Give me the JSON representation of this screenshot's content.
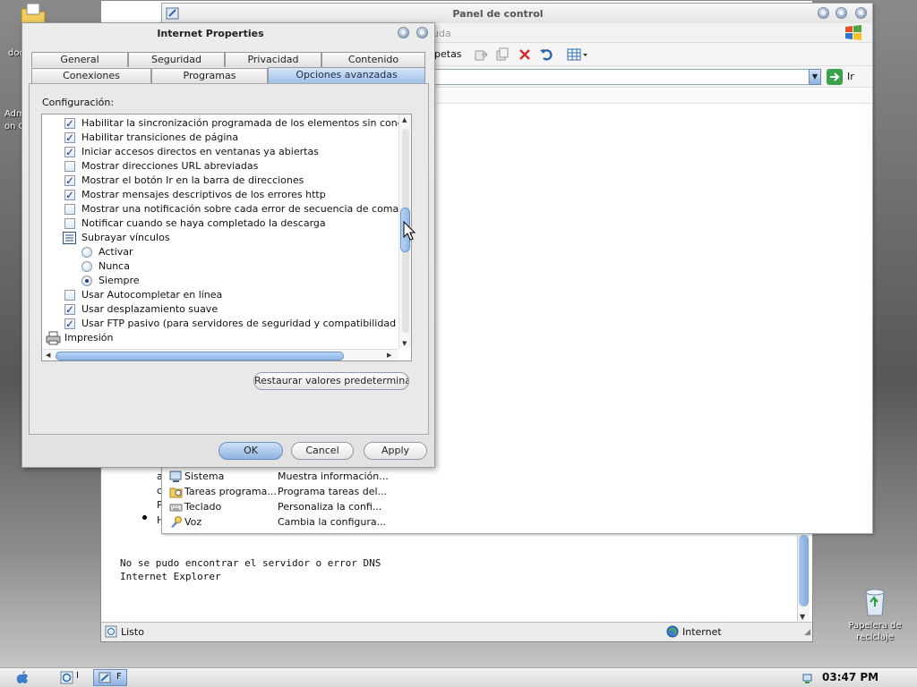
{
  "desktop": {
    "icon_left_labels": [
      "doc",
      "Adm",
      "on C"
    ],
    "recycle_bin_label": "Papelera de reciclaje"
  },
  "ie_window": {
    "bullets": [
      "a",
      "c",
      "P",
      "H"
    ],
    "error_text_1": "No se pudo encontrar el servidor o error DNS",
    "error_text_2": "Internet Explorer",
    "status_left": "Listo",
    "status_zone": "Internet"
  },
  "control_panel": {
    "title": "Panel de control",
    "menu_fragment": "uda",
    "toolbar_fragment": "petas",
    "go_label": "Ir",
    "items": [
      {
        "name": "Sistema",
        "desc": "Muestra información..."
      },
      {
        "name": "Tareas programa...",
        "desc": "Programa tareas del..."
      },
      {
        "name": "Teclado",
        "desc": "Personaliza la confi..."
      },
      {
        "name": "Voz",
        "desc": "Cambia la configura..."
      }
    ]
  },
  "dialog": {
    "title": "Internet Properties",
    "tabs_row1": [
      "General",
      "Seguridad",
      "Privacidad",
      "Contenido"
    ],
    "tabs_row2": [
      "Conexiones",
      "Programas",
      "Opciones avanzadas"
    ],
    "selected_tab": "Opciones avanzadas",
    "config_label": "Configuración:",
    "settings": [
      {
        "type": "checkbox",
        "checked": true,
        "label": "Habilitar la sincronización programada de los elementos sin conexión"
      },
      {
        "type": "checkbox",
        "checked": true,
        "label": "Habilitar transiciones de página"
      },
      {
        "type": "checkbox",
        "checked": true,
        "label": "Iniciar accesos directos en ventanas ya abiertas"
      },
      {
        "type": "checkbox",
        "checked": false,
        "label": "Mostrar direcciones URL abreviadas"
      },
      {
        "type": "checkbox",
        "checked": true,
        "label": "Mostrar el botón Ir en la barra de direcciones"
      },
      {
        "type": "checkbox",
        "checked": true,
        "label": "Mostrar mensajes descriptivos de los errores http"
      },
      {
        "type": "checkbox",
        "checked": false,
        "label": "Mostrar una notificación sobre cada error de secuencia de comandos"
      },
      {
        "type": "checkbox",
        "checked": false,
        "label": "Notificar cuando se haya completado la descarga"
      },
      {
        "type": "group",
        "label": "Subrayar vínculos"
      },
      {
        "type": "radio",
        "checked": false,
        "label": "Activar"
      },
      {
        "type": "radio",
        "checked": false,
        "label": "Nunca"
      },
      {
        "type": "radio",
        "checked": true,
        "label": "Siempre"
      },
      {
        "type": "checkbox",
        "checked": false,
        "label": "Usar Autocompletar en línea"
      },
      {
        "type": "checkbox",
        "checked": true,
        "label": "Usar desplazamiento suave"
      },
      {
        "type": "checkbox",
        "checked": true,
        "label": "Usar FTP pasivo (para servidores de seguridad y compatibilidad con módem"
      },
      {
        "type": "category",
        "label": "Impresión"
      }
    ],
    "restore_button": "Restaurar valores predeterminados",
    "ok_button": "OK",
    "cancel_button": "Cancel",
    "apply_button": "Apply"
  },
  "taskbar": {
    "task1_fragment": "I",
    "task2_fragment": "F",
    "clock": "03:47 PM"
  },
  "colors": {
    "selected_tab": "#9fc0e8",
    "check": "#1c3f75",
    "scrollbar": "#8fb7e6"
  }
}
